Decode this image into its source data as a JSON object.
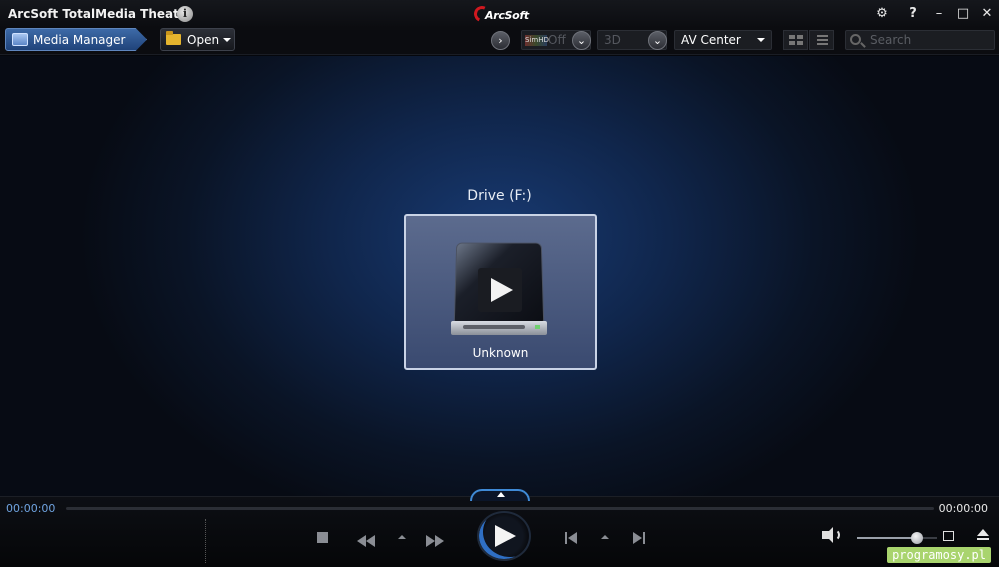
{
  "window": {
    "title": "ArcSoft TotalMedia Theatre",
    "brand": "ArcSoft",
    "brand_color": "#d0181f"
  },
  "window_controls": {
    "settings": "⚙",
    "help": "?",
    "minimize": "–",
    "maximize": "□",
    "close": "✕"
  },
  "toolbar": {
    "media_manager_label": "Media Manager",
    "open_label": "Open",
    "simhd_logo": "SimHD",
    "simhd_state": "Off",
    "mode_3d": "3D",
    "av_mode": "AV Center",
    "search_placeholder": "Search"
  },
  "main": {
    "drive_title": "Drive (F:)",
    "disc_label": "Unknown"
  },
  "controls": {
    "time_elapsed": "00:00:00",
    "time_total": "00:00:00",
    "progress_fraction": 0.0,
    "volume_fraction": 0.75,
    "accent_color": "#3f8ad6"
  },
  "watermark": "programosy.pl"
}
